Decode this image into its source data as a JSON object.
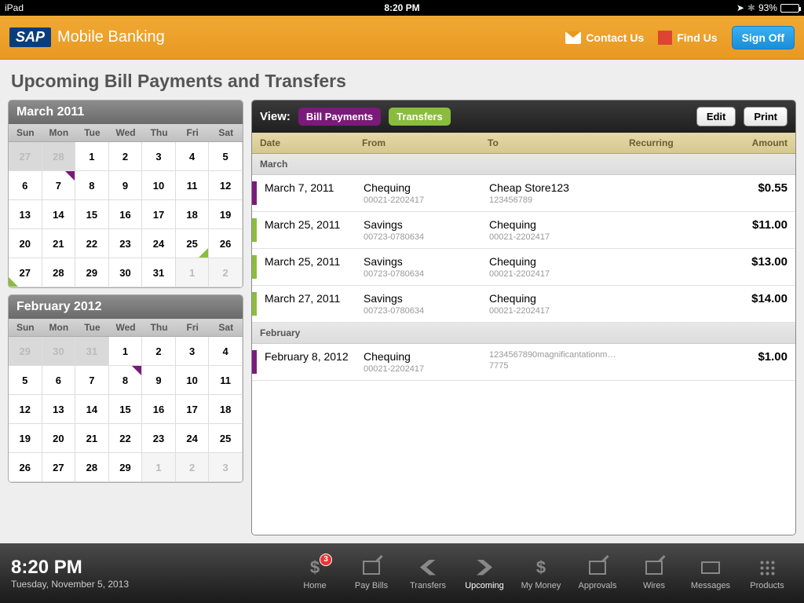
{
  "status": {
    "device": "iPad",
    "time": "8:20 PM",
    "battery": "93%"
  },
  "header": {
    "logo": "SAP",
    "title": "Mobile Banking",
    "contact": "Contact Us",
    "find": "Find Us",
    "signoff": "Sign Off"
  },
  "page_title": "Upcoming Bill Payments and Transfers",
  "view": {
    "label": "View:",
    "bill": "Bill Payments",
    "transfers": "Transfers",
    "edit": "Edit",
    "print": "Print"
  },
  "columns": {
    "date": "Date",
    "from": "From",
    "to": "To",
    "recurring": "Recurring",
    "amount": "Amount"
  },
  "calendars": [
    {
      "title": "March 2011",
      "dow": [
        "Sun",
        "Mon",
        "Tue",
        "Wed",
        "Thu",
        "Fri",
        "Sat"
      ],
      "cells": [
        {
          "n": "27",
          "dim": true,
          "sel": true
        },
        {
          "n": "28",
          "dim": true,
          "sel": true
        },
        {
          "n": "1"
        },
        {
          "n": "2"
        },
        {
          "n": "3"
        },
        {
          "n": "4"
        },
        {
          "n": "5"
        },
        {
          "n": "6"
        },
        {
          "n": "7",
          "marker": "tr"
        },
        {
          "n": "8"
        },
        {
          "n": "9"
        },
        {
          "n": "10"
        },
        {
          "n": "11"
        },
        {
          "n": "12"
        },
        {
          "n": "13"
        },
        {
          "n": "14"
        },
        {
          "n": "15"
        },
        {
          "n": "16"
        },
        {
          "n": "17"
        },
        {
          "n": "18"
        },
        {
          "n": "19"
        },
        {
          "n": "20"
        },
        {
          "n": "21"
        },
        {
          "n": "22"
        },
        {
          "n": "23"
        },
        {
          "n": "24"
        },
        {
          "n": "25",
          "marker": "br"
        },
        {
          "n": "26"
        },
        {
          "n": "27",
          "marker": "bl"
        },
        {
          "n": "28"
        },
        {
          "n": "29"
        },
        {
          "n": "30"
        },
        {
          "n": "31"
        },
        {
          "n": "1",
          "dim": true
        },
        {
          "n": "2",
          "dim": true
        }
      ]
    },
    {
      "title": "February 2012",
      "dow": [
        "Sun",
        "Mon",
        "Tue",
        "Wed",
        "Thu",
        "Fri",
        "Sat"
      ],
      "cells": [
        {
          "n": "29",
          "dim": true,
          "sel": true
        },
        {
          "n": "30",
          "dim": true,
          "sel": true
        },
        {
          "n": "31",
          "dim": true,
          "sel": true
        },
        {
          "n": "1"
        },
        {
          "n": "2"
        },
        {
          "n": "3"
        },
        {
          "n": "4"
        },
        {
          "n": "5"
        },
        {
          "n": "6"
        },
        {
          "n": "7"
        },
        {
          "n": "8",
          "marker": "tr"
        },
        {
          "n": "9"
        },
        {
          "n": "10"
        },
        {
          "n": "11"
        },
        {
          "n": "12"
        },
        {
          "n": "13"
        },
        {
          "n": "14"
        },
        {
          "n": "15"
        },
        {
          "n": "16"
        },
        {
          "n": "17"
        },
        {
          "n": "18"
        },
        {
          "n": "19"
        },
        {
          "n": "20"
        },
        {
          "n": "21"
        },
        {
          "n": "22"
        },
        {
          "n": "23"
        },
        {
          "n": "24"
        },
        {
          "n": "25"
        },
        {
          "n": "26"
        },
        {
          "n": "27"
        },
        {
          "n": "28"
        },
        {
          "n": "29"
        },
        {
          "n": "1",
          "dim": true
        },
        {
          "n": "2",
          "dim": true
        },
        {
          "n": "3",
          "dim": true
        }
      ]
    }
  ],
  "sections": [
    {
      "label": "March",
      "rows": [
        {
          "color": "purple",
          "date": "March 7, 2011",
          "from": "Chequing",
          "from_sub": "00021-2202417",
          "to": "Cheap Store123",
          "to_sub": "123456789",
          "amount": "$0.55"
        },
        {
          "color": "green",
          "date": "March 25, 2011",
          "from": "Savings",
          "from_sub": "00723-0780634",
          "to": "Chequing",
          "to_sub": "00021-2202417",
          "amount": "$11.00"
        },
        {
          "color": "green",
          "date": "March 25, 2011",
          "from": "Savings",
          "from_sub": "00723-0780634",
          "to": "Chequing",
          "to_sub": "00021-2202417",
          "amount": "$13.00"
        },
        {
          "color": "green",
          "date": "March 27, 2011",
          "from": "Savings",
          "from_sub": "00723-0780634",
          "to": "Chequing",
          "to_sub": "00021-2202417",
          "amount": "$14.00"
        }
      ]
    },
    {
      "label": "February",
      "rows": [
        {
          "color": "purple",
          "date": "February 8, 2012",
          "from": "Chequing",
          "from_sub": "00021-2202417",
          "to": "1234567890magnificantationm…",
          "to_sub": "7775",
          "amount": "$1.00"
        }
      ]
    }
  ],
  "footer": {
    "time": "8:20 PM",
    "date": "Tuesday, November 5, 2013",
    "badge": "3",
    "nav": [
      "Home",
      "Pay Bills",
      "Transfers",
      "Upcoming",
      "My Money",
      "Approvals",
      "Wires",
      "Messages",
      "Products"
    ]
  }
}
